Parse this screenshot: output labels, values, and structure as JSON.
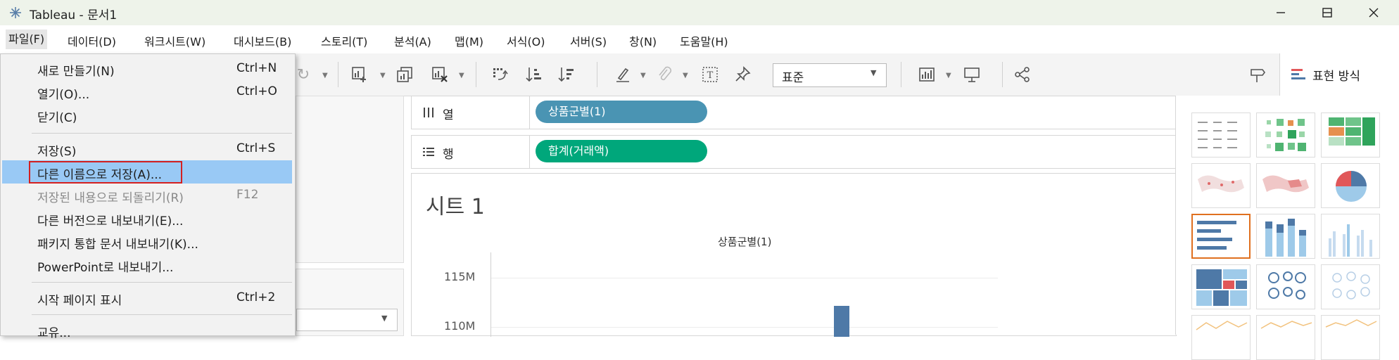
{
  "window": {
    "title": "Tableau - 문서1",
    "icons": [
      "tableau-logo-icon",
      "minimize-icon",
      "maximize-icon",
      "close-icon"
    ]
  },
  "menubar": {
    "items": [
      "파일(F)",
      "데이터(D)",
      "워크시트(W)",
      "대시보드(B)",
      "스토리(T)",
      "분석(A)",
      "맵(M)",
      "서식(O)",
      "서버(S)",
      "창(N)",
      "도움말(H)"
    ]
  },
  "toolbar": {
    "fit_value": "표준",
    "show_me_label": "표현 방식"
  },
  "file_menu": {
    "items": [
      {
        "label": "새로 만들기(N)",
        "shortcut": "Ctrl+N",
        "disabled": false
      },
      {
        "label": "열기(O)...",
        "shortcut": "Ctrl+O",
        "disabled": false
      },
      {
        "label": "닫기(C)",
        "shortcut": "",
        "disabled": false
      },
      {
        "label": "저장(S)",
        "shortcut": "Ctrl+S",
        "disabled": false
      },
      {
        "label": "다른 이름으로 저장(A)...",
        "shortcut": "",
        "disabled": false,
        "highlighted": true
      },
      {
        "label": "저장된 내용으로 되돌리기(R)",
        "shortcut": "F12",
        "disabled": true
      },
      {
        "label": "다른 버전으로 내보내기(E)...",
        "shortcut": "",
        "disabled": false
      },
      {
        "label": "패키지 통합 문서 내보내기(K)...",
        "shortcut": "",
        "disabled": false
      },
      {
        "label": "PowerPoint로 내보내기...",
        "shortcut": "",
        "disabled": false
      },
      {
        "label": "시작 페이지 표시",
        "shortcut": "Ctrl+2",
        "disabled": false
      },
      {
        "label": "교유...",
        "shortcut": "",
        "disabled": false
      }
    ]
  },
  "shelves": {
    "columns": {
      "label": "열",
      "pill": "상품군별(1)",
      "color": "#4a94b3"
    },
    "rows": {
      "label": "행",
      "pill": "합계(거래액)",
      "color": "#00a77b"
    }
  },
  "view": {
    "sheet_title": "시트 1",
    "chart_data": {
      "type": "bar",
      "title": "",
      "column_header": "상품군별(1)",
      "y_ticks": [
        "115M",
        "110M"
      ],
      "bar_color": "#4e79a7",
      "values_visible": "cropped"
    }
  },
  "showme": {
    "thumbnails": [
      "text-table",
      "heat-map",
      "highlight-table",
      "symbol-map",
      "filled-map",
      "pie-chart",
      "horizontal-bars",
      "stacked-bars",
      "side-by-side-bars",
      "treemap",
      "circle-views",
      "side-by-side-circles",
      "line-continuous",
      "line-discrete",
      "dual-lines"
    ],
    "selected": "horizontal-bars"
  }
}
